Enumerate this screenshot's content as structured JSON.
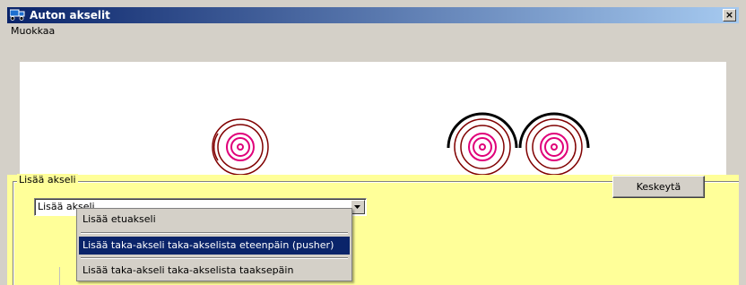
{
  "window": {
    "title": "Auton akselit",
    "close_glyph": "×",
    "icon": "truck-icon"
  },
  "menu": {
    "items": [
      {
        "label": "Muokkaa"
      }
    ]
  },
  "canvas": {
    "wheels": [
      {
        "type": "single-wheel",
        "mudguard": false
      },
      {
        "type": "tandem-wheel",
        "mudguard": true
      },
      {
        "type": "tandem-wheel",
        "mudguard": true
      }
    ],
    "colors": {
      "tire": "#800000",
      "hub": "#e0007a",
      "mudguard": "#000000"
    }
  },
  "panel": {
    "group_label": "Lisää akseli",
    "background": "#ffff99",
    "cancel_label": "Keskeytä",
    "combo": {
      "value": "Lisää akseli",
      "options": [
        {
          "label": "Lisää etuakseli",
          "selected": false
        },
        {
          "label": "Lisää taka-akseli  taka-akselista eteenpäin (pusher)",
          "selected": true
        },
        {
          "label": "Lisää taka-akseli  taka-akselista taaksepäin",
          "selected": false
        }
      ]
    }
  },
  "colors": {
    "titlebar_start": "#0a246a",
    "titlebar_end": "#a6caf0",
    "highlight": "#0a246a",
    "dialog_face": "#d4d0c8"
  }
}
